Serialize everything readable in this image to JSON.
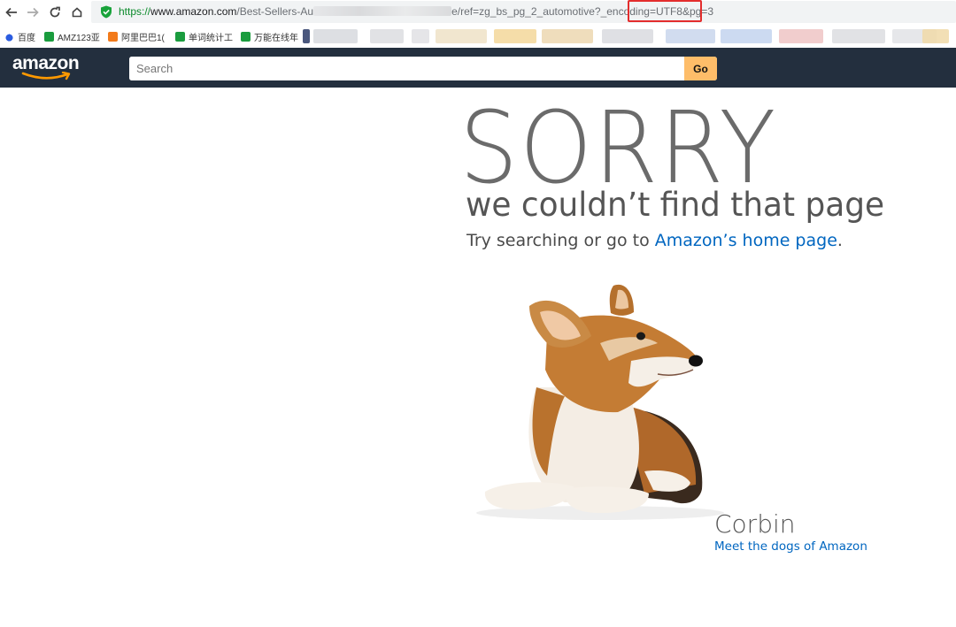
{
  "browser": {
    "url": {
      "scheme": "https://",
      "host": "www.amazon.com",
      "path_start": "/Best-Sellers-Au",
      "path_end": "e/ref=zg_bs_pg_2_automotive?_encoding",
      "path_highlight": "=UTF8&pg=3"
    },
    "bookmarks": [
      {
        "label": "百度",
        "icon": "baidu-icon",
        "color": "#2b5ce0"
      },
      {
        "label": "AMZ123亚",
        "icon": "amz123-icon",
        "color": "#1a9c3e"
      },
      {
        "label": "阿里巴巴1(",
        "icon": "alibaba-icon",
        "color": "#f27a1a"
      },
      {
        "label": "单词统计工",
        "icon": "wordcount-icon",
        "color": "#1a9c3e"
      },
      {
        "label": "万能在线年",
        "icon": "tool-icon",
        "color": "#1a9c3e"
      }
    ]
  },
  "header": {
    "logo": "amazon",
    "search_placeholder": "Search",
    "go_label": "Go"
  },
  "error": {
    "title": "SORRY",
    "subtitle": "we couldn’t find that page",
    "line_prefix": "Try searching or go to ",
    "home_link": "Amazon’s home page",
    "line_suffix": "."
  },
  "dog": {
    "name": "Corbin",
    "link": "Meet the dogs of Amazon"
  },
  "colors": {
    "header_bg": "#232f3e",
    "go_button": "#febd69",
    "link": "#0066c0",
    "url_highlight": "#e32d2d"
  }
}
